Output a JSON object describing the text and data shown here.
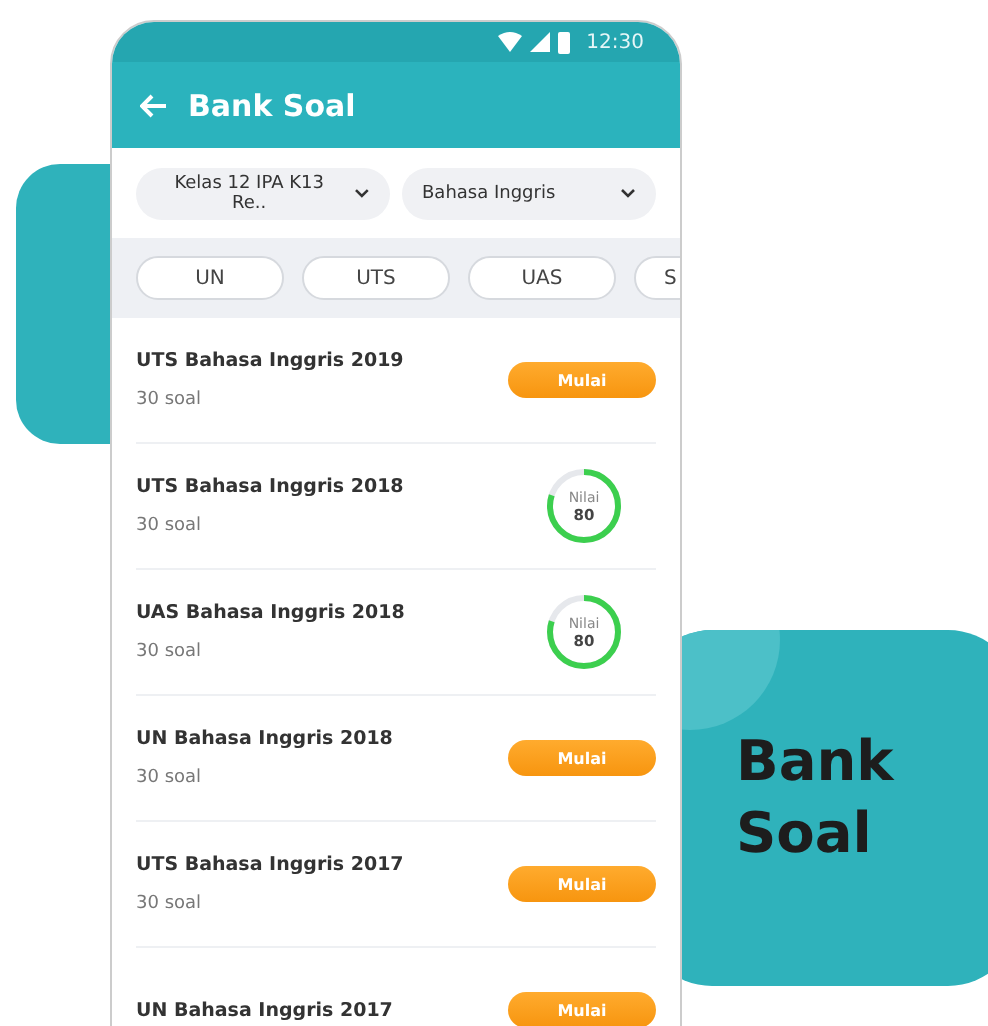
{
  "status_bar": {
    "time": "12:30"
  },
  "app_bar": {
    "title": "Bank Soal"
  },
  "filters": [
    {
      "value": "Kelas 12 IPA K13 Re.."
    },
    {
      "value": "Bahasa Inggris"
    }
  ],
  "tabs": [
    "UN",
    "UTS",
    "UAS",
    "S"
  ],
  "items": [
    {
      "kind": "start",
      "title": "UTS Bahasa Inggris 2019",
      "subtitle": "30 soal",
      "action": "Mulai"
    },
    {
      "kind": "score",
      "title": "UTS Bahasa Inggris 2018",
      "subtitle": "30 soal",
      "score_label": "Nilai",
      "score": "80",
      "level": 0.8
    },
    {
      "kind": "score",
      "title": "UAS Bahasa Inggris 2018",
      "subtitle": "30 soal",
      "score_label": "Nilai",
      "score": "80",
      "level": 0.8
    },
    {
      "kind": "start",
      "title": "UN Bahasa Inggris 2018",
      "subtitle": "30 soal",
      "action": "Mulai"
    },
    {
      "kind": "start",
      "title": "UTS Bahasa Inggris 2017",
      "subtitle": "30 soal",
      "action": "Mulai"
    },
    {
      "kind": "start",
      "title": "UN Bahasa Inggris 2017",
      "action": "Mulai"
    }
  ],
  "promo": {
    "caption_lines": [
      "Bank",
      "Soal"
    ]
  }
}
